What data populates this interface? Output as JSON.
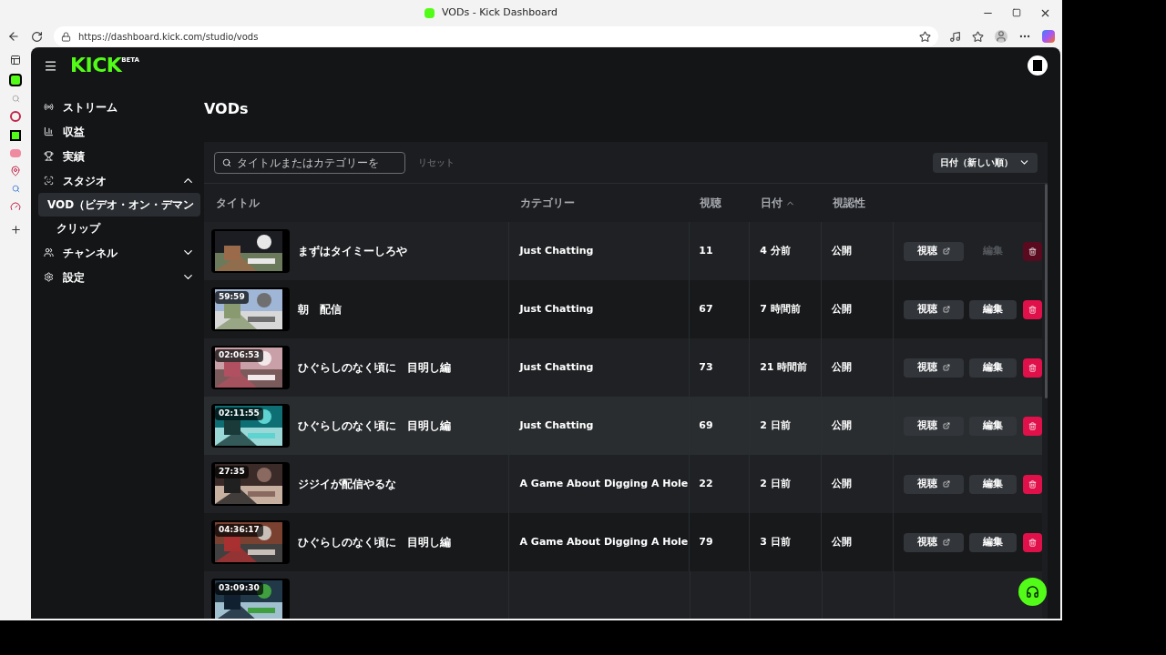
{
  "browser": {
    "tab_title": "VODs - Kick Dashboard",
    "url": "https://dashboard.kick.com/studio/vods"
  },
  "header": {
    "logo": "KICK",
    "logo_badge": "BETA"
  },
  "sidebar": {
    "items": [
      {
        "label": "ストリーム",
        "selected": false
      },
      {
        "label": "収益",
        "selected": false
      },
      {
        "label": "実績",
        "selected": false
      },
      {
        "label": "スタジオ",
        "selected": false,
        "expanded": true,
        "children": [
          {
            "label": "VOD（ビデオ・オン・デマン",
            "selected": true
          },
          {
            "label": "クリップ",
            "selected": false
          }
        ]
      },
      {
        "label": "チャンネル",
        "selected": false,
        "expanded": false
      },
      {
        "label": "設定",
        "selected": false,
        "expanded": false
      }
    ]
  },
  "page_title": "VODs",
  "toolbar": {
    "search_placeholder": "タイトルまたはカテゴリーを",
    "reset": {
      "label": "リセット",
      "disabled": true
    },
    "sort": "日付（新しい順）"
  },
  "table": {
    "columns": [
      {
        "label": "タイトル",
        "sorted": false
      },
      {
        "label": "カテゴリー",
        "sorted": false
      },
      {
        "label": "視聴",
        "sorted": false
      },
      {
        "label": "日付",
        "sorted": true
      },
      {
        "label": "視認性",
        "sorted": false
      }
    ],
    "rows": [
      {
        "title": "まずはタイミーしろや",
        "category": "Just Chatting",
        "views": "11",
        "date": "4 分前",
        "visibility": "公開",
        "watch": "視聴",
        "edit": "編集",
        "disabled": true,
        "hovered": false
      },
      {
        "duration": "59:59",
        "title": "朝　配信",
        "category": "Just Chatting",
        "views": "67",
        "date": "7 時間前",
        "visibility": "公開",
        "watch": "視聴",
        "edit": "編集",
        "disabled": false,
        "hovered": false
      },
      {
        "duration": "02:06:53",
        "title": "ひぐらしのなく頃に　目明し編",
        "category": "Just Chatting",
        "views": "73",
        "date": "21 時間前",
        "visibility": "公開",
        "watch": "視聴",
        "edit": "編集",
        "disabled": false,
        "hovered": false
      },
      {
        "duration": "02:11:55",
        "title": "ひぐらしのなく頃に　目明し編",
        "category": "Just Chatting",
        "views": "69",
        "date": "2 日前",
        "visibility": "公開",
        "watch": "視聴",
        "edit": "編集",
        "disabled": false,
        "hovered": true
      },
      {
        "duration": "27:35",
        "title": "ジジイが配信やるな",
        "category": "A Game About Digging A Hole",
        "views": "22",
        "date": "2 日前",
        "visibility": "公開",
        "watch": "視聴",
        "edit": "編集",
        "disabled": false,
        "hovered": false
      },
      {
        "duration": "04:36:17",
        "title": "ひぐらしのなく頃に　目明し編",
        "category": "A Game About Digging A Hole",
        "views": "79",
        "date": "3 日前",
        "visibility": "公開",
        "watch": "視聴",
        "edit": "編集",
        "disabled": false,
        "hovered": false
      },
      {
        "duration": "03:09:30"
      }
    ]
  }
}
